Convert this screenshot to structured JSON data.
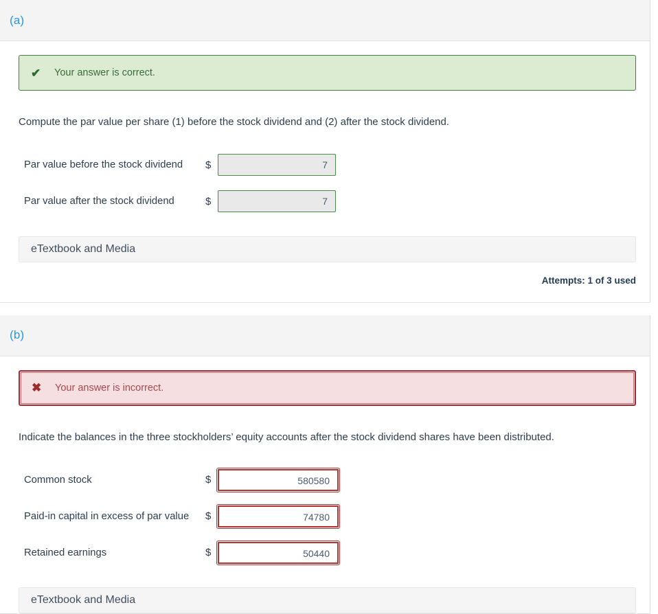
{
  "parts": [
    {
      "label": "(a)",
      "status": {
        "type": "correct",
        "icon": "check-icon",
        "glyph": "✔",
        "message": "Your answer is correct.",
        "bg_color": "#dcecd2",
        "border_color": "#3f7d3f",
        "text_color": "#3c6b3c"
      },
      "prompt": "Compute the par value per share (1) before the stock dividend and (2) after the stock dividend.",
      "rows": [
        {
          "label": "Par value before the stock dividend",
          "currency": "$",
          "value": "7"
        },
        {
          "label": "Par value after the stock dividend",
          "currency": "$",
          "value": "7"
        }
      ],
      "etextbook_label": "eTextbook and Media",
      "attempts": "Attempts: 1 of 3 used"
    },
    {
      "label": "(b)",
      "status": {
        "type": "incorrect",
        "icon": "cross-icon",
        "glyph": "✖",
        "message": "Your answer is incorrect.",
        "bg_color": "#f5dfe0",
        "border_color": "#a32b32",
        "text_color": "#a8484f"
      },
      "prompt": "Indicate the balances in the three stockholders’ equity accounts after the stock dividend shares have been distributed.",
      "rows": [
        {
          "label": "Common stock",
          "currency": "$",
          "value": "580580"
        },
        {
          "label": "Paid-in capital in excess of par value",
          "currency": "$",
          "value": "74780"
        },
        {
          "label": "Retained earnings",
          "currency": "$",
          "value": "50440"
        }
      ],
      "etextbook_label": "eTextbook and Media"
    }
  ],
  "theme": {
    "part_label_color": "#2196f3",
    "panel_header_bg": "#f4f4f4",
    "text_color": "#2c3e50"
  }
}
